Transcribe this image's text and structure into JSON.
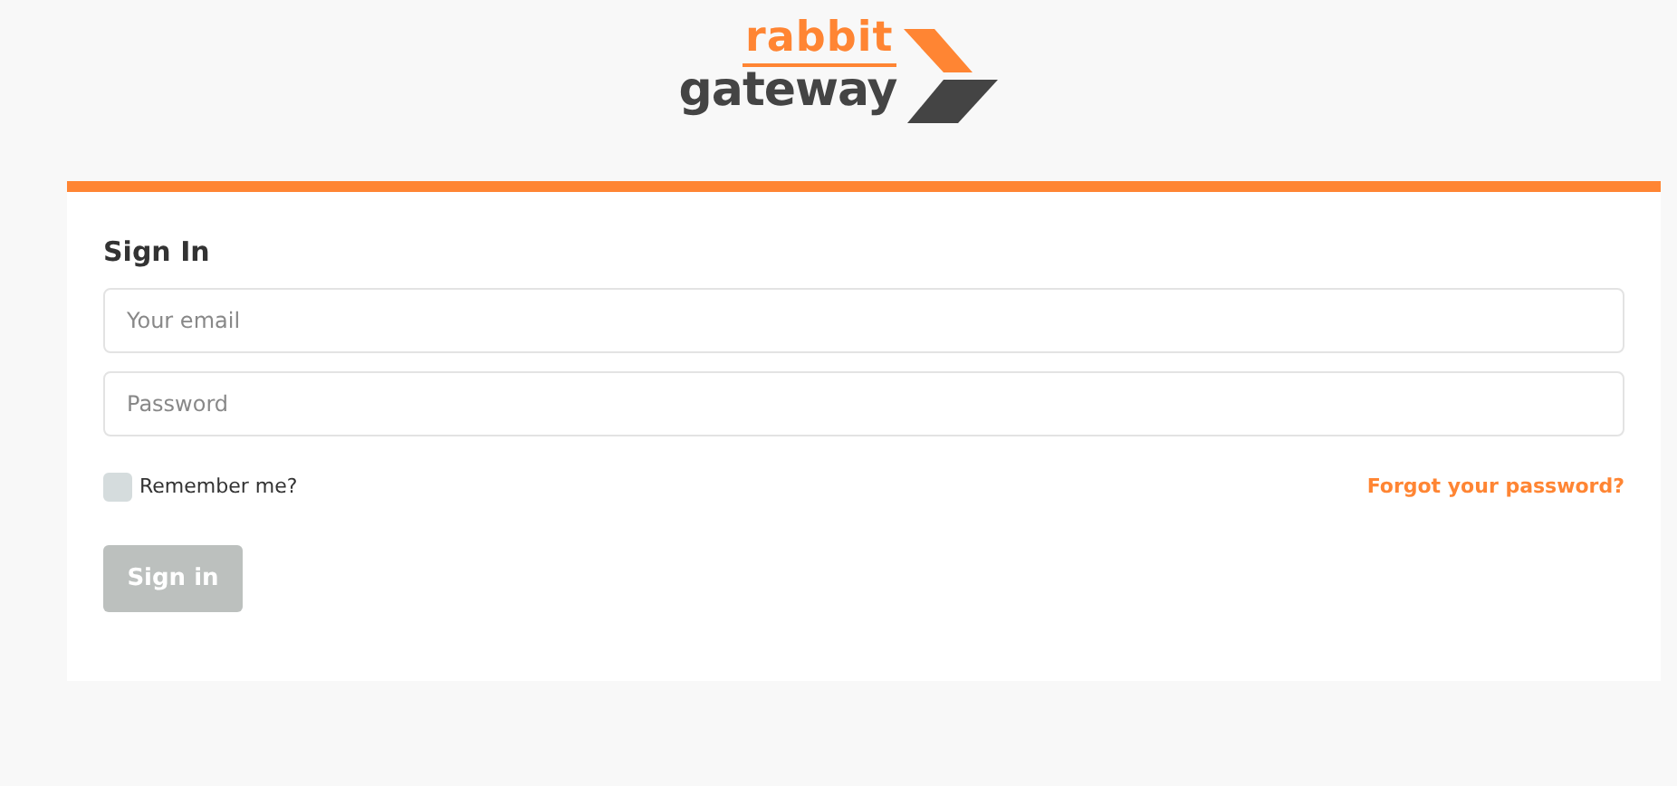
{
  "logo": {
    "top": "rabbit",
    "bottom": "gateway"
  },
  "form": {
    "title": "Sign In",
    "fields": [
      {
        "placeholder": "Your email"
      },
      {
        "placeholder": "Password"
      }
    ],
    "remember": {
      "label": "Remember me?",
      "checked": false
    },
    "forgot_link": "Forgot your password?",
    "submit": {
      "label": "Sign in",
      "disabled": true
    }
  }
}
